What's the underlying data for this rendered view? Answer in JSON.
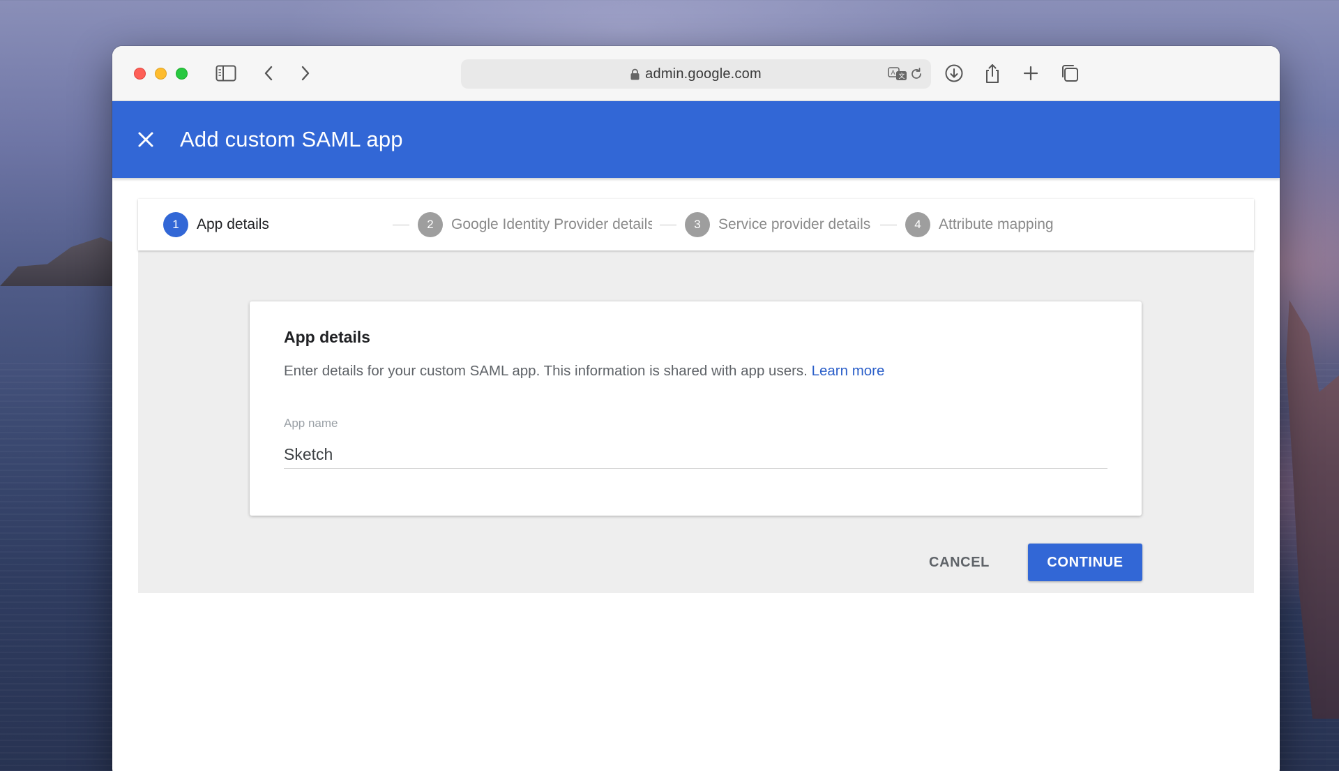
{
  "browser": {
    "url": "admin.google.com",
    "icons": {
      "sidebar": "sidebar-toggle-icon",
      "back": "chevron-left-icon",
      "forward": "chevron-right-icon",
      "translate": "translate-icon",
      "reload": "reload-icon",
      "download": "download-icon",
      "share": "share-icon",
      "new_tab": "plus-icon",
      "tabs": "tab-overview-icon",
      "lock": "lock-icon"
    }
  },
  "header": {
    "title": "Add custom SAML app",
    "close_icon": "close-icon",
    "color": "#3267d6"
  },
  "stepper": {
    "steps": [
      {
        "number": "1",
        "label": "App details",
        "active": true
      },
      {
        "number": "2",
        "label": "Google Identity Provider details",
        "active": false
      },
      {
        "number": "3",
        "label": "Service provider details",
        "active": false
      },
      {
        "number": "4",
        "label": "Attribute mapping",
        "active": false
      }
    ]
  },
  "card": {
    "title": "App details",
    "description": "Enter details for your custom SAML app. This information is shared with app users.",
    "learn_more": "Learn more",
    "app_name_label": "App name",
    "app_name_value": "Sketch"
  },
  "actions": {
    "cancel": "CANCEL",
    "continue": "CONTINUE"
  }
}
